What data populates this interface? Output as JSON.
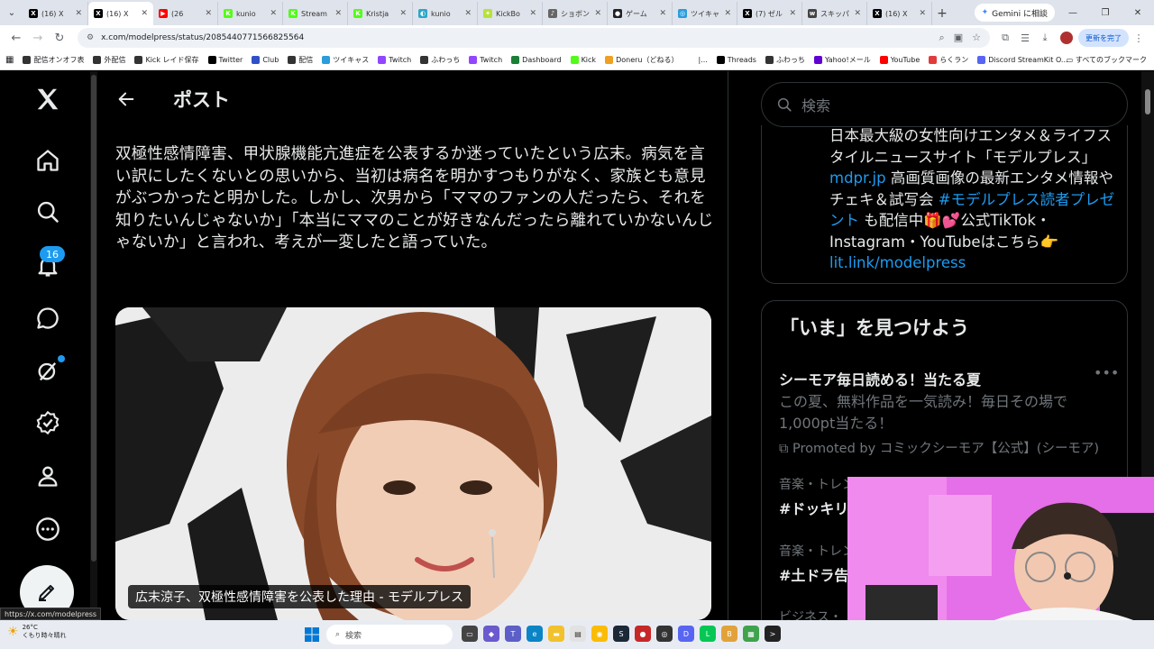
{
  "browser": {
    "tabs": [
      {
        "label": "(16) X",
        "fav": "X",
        "color": "#000000",
        "active": false
      },
      {
        "label": "(16) X",
        "fav": "X",
        "color": "#000000",
        "active": true
      },
      {
        "label": "(26",
        "fav": "▶",
        "color": "#ff0000",
        "active": false
      },
      {
        "label": "kunio",
        "fav": "K",
        "color": "#53fc18",
        "active": false
      },
      {
        "label": "Stream",
        "fav": "K",
        "color": "#53fc18",
        "active": false
      },
      {
        "label": "Kristja",
        "fav": "K",
        "color": "#53fc18",
        "active": false
      },
      {
        "label": "kunio",
        "fav": "◐",
        "color": "#2aa7c9",
        "active": false
      },
      {
        "label": "KickBo",
        "fav": "✦",
        "color": "#b7e23a",
        "active": false
      },
      {
        "label": "ショボン",
        "fav": "♪",
        "color": "#666666",
        "active": false
      },
      {
        "label": "ゲーム",
        "fav": "●",
        "color": "#222222",
        "active": false
      },
      {
        "label": "ツイキャ",
        "fav": "◎",
        "color": "#2b9cdc",
        "active": false
      },
      {
        "label": "(7) ゼル",
        "fav": "X",
        "color": "#000000",
        "active": false
      },
      {
        "label": "スキッパ",
        "fav": "w",
        "color": "#444444",
        "active": false
      },
      {
        "label": "(16) X",
        "fav": "X",
        "color": "#000000",
        "active": false
      }
    ],
    "gemini_label": "Gemini に相談",
    "url": "x.com/modelpress/status/2085440771566825564",
    "update_label": "更新を完了",
    "bookmarks": [
      {
        "label": "配信オンオフ表",
        "color": "#333333"
      },
      {
        "label": "外配信",
        "color": "#333333"
      },
      {
        "label": "Kick レイド保存",
        "color": "#333333"
      },
      {
        "label": "Twitter",
        "color": "#000000"
      },
      {
        "label": "Club",
        "color": "#3050c8"
      },
      {
        "label": "配信",
        "color": "#333333"
      },
      {
        "label": "ツイキャス",
        "color": "#2b9cdc"
      },
      {
        "label": "Twitch",
        "color": "#9146ff"
      },
      {
        "label": "ふわっち",
        "color": "#333333"
      },
      {
        "label": "Twitch",
        "color": "#9146ff"
      },
      {
        "label": "Dashboard",
        "color": "#1a7f37"
      },
      {
        "label": "Kick",
        "color": "#53fc18"
      },
      {
        "label": "Doneru（どねる）",
        "color": "#f0a020"
      },
      {
        "label": "|...",
        "color": "#ffffff"
      },
      {
        "label": "Threads",
        "color": "#000000"
      },
      {
        "label": "ふわっち",
        "color": "#333333"
      },
      {
        "label": "Yahoo!メール",
        "color": "#6001d2"
      },
      {
        "label": "YouTube",
        "color": "#ff0000"
      },
      {
        "label": "らくラン",
        "color": "#e23b3b"
      },
      {
        "label": "Discord StreamKit O...",
        "color": "#5865f2"
      }
    ],
    "all_bookmarks": "すべてのブックマーク",
    "status_url": "https://x.com/modelpress"
  },
  "x": {
    "header_title": "ポスト",
    "notification_count": "16",
    "post_text": "双極性感情障害、甲状腺機能亢進症を公表するか迷っていたという広末。病気を言い訳にしたくないとの思いから、当初は病名を明かすつもりがなく、家族とも意見がぶつかったと明かした。しかし、次男から「ママのファンの人だったら、それを知りたいんじゃないか」「本当にママのことが好きなんだったら離れていかないんじゃないか」と言われ、考えが一変したと語っていた。",
    "media_caption": "広末涼子、双極性感情障害を公表した理由 - モデルプレス",
    "search_placeholder": "検索",
    "bio": {
      "line1": "日本最大級の女性向けエンタメ＆ライフスタイルニュースサイト「モデルプレス」",
      "link1": "mdpr.jp",
      "line2": " 高画質画像の最新エンタメ情報やチェキ＆試写会 ",
      "link2": "#モデルプレス読者プレゼント",
      "line3": " も配信中🎁💕公式TikTok・Instagram・YouTubeはこちら👉",
      "link3": "lit.link/modelpress"
    },
    "trends_title": "「いま」を見つけよう",
    "promo": {
      "title": "シーモア毎日読める！当たる夏",
      "desc": "この夏、無料作品を一気読み！毎日その場で1,000pt当たる！",
      "by": "Promoted by コミックシーモア【公式】(シーモア)"
    },
    "trends": [
      {
        "category": "音楽・トレンド",
        "tag": "#ドッキリ"
      },
      {
        "category": "音楽・トレンド",
        "tag": "#土ドラ告"
      },
      {
        "category": "ビジネス・",
        "tag": ""
      }
    ]
  },
  "taskbar": {
    "temperature": "26°C",
    "weather": "くもり時々晴れ",
    "search_label": "検索"
  }
}
